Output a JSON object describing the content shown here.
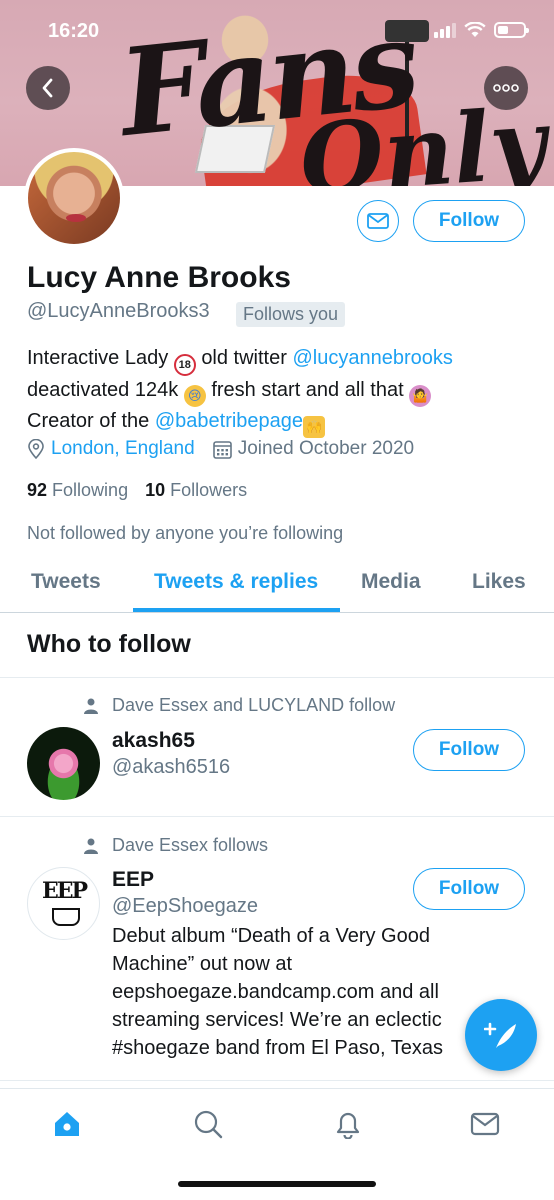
{
  "status_bar": {
    "time": "16:20"
  },
  "banner": {
    "text_line1": "Fans",
    "text_line2": "Only"
  },
  "profile": {
    "name": "Lucy Anne Brooks",
    "handle": "@LucyAnneBrooks3",
    "follows_you": "Follows you",
    "follow_label": "Follow",
    "bio": {
      "line1_a": "Interactive Lady ",
      "line1_emoji": "18",
      "line1_b": "old twitter ",
      "line1_link": "@lucyannebrooks",
      "line2_a": "deactivated 124k ",
      "line2_emoji": "😢",
      "line2_b": " fresh start and all that ",
      "line2_emoji2": "🤷",
      "line3_a": "Creator of the ",
      "line3_link": "@babetribepage",
      "line3_emoji": "🙌"
    },
    "location": "London, England",
    "joined": "Joined October 2020",
    "following_count": "92",
    "following_label": "Following",
    "followers_count": "10",
    "followers_label": "Followers",
    "not_followed": "Not followed by anyone you’re following"
  },
  "tabs": [
    "Tweets",
    "Tweets & replies",
    "Media",
    "Likes"
  ],
  "active_tab": "Tweets & replies",
  "who_to_follow": {
    "title": "Who to follow",
    "users": [
      {
        "context": "Dave Essex and LUCYLAND follow",
        "name": "akash65",
        "handle": "@akash6516",
        "follow_label": "Follow"
      },
      {
        "context": "Dave Essex follows",
        "name": "EEP",
        "handle": "@EepShoegaze",
        "follow_label": "Follow",
        "bio_lines": [
          "Debut album “Death of a Very Good",
          "Machine” out now at",
          "eepshoegaze.bandcamp.com and all",
          "streaming services! We’re an eclectic",
          "#shoegaze band from El Paso, Texas"
        ]
      }
    ]
  },
  "colors": {
    "accent": "#1da1f2",
    "secondary_text": "#657786"
  },
  "icons": {
    "back": "chevron-left-icon",
    "more": "more-icon",
    "message": "mail-icon",
    "location": "location-pin-icon",
    "calendar": "calendar-icon",
    "person": "person-icon",
    "compose": "compose-icon",
    "home": "home-icon",
    "search": "search-icon",
    "notifications": "bell-icon",
    "messages": "mail-icon"
  }
}
